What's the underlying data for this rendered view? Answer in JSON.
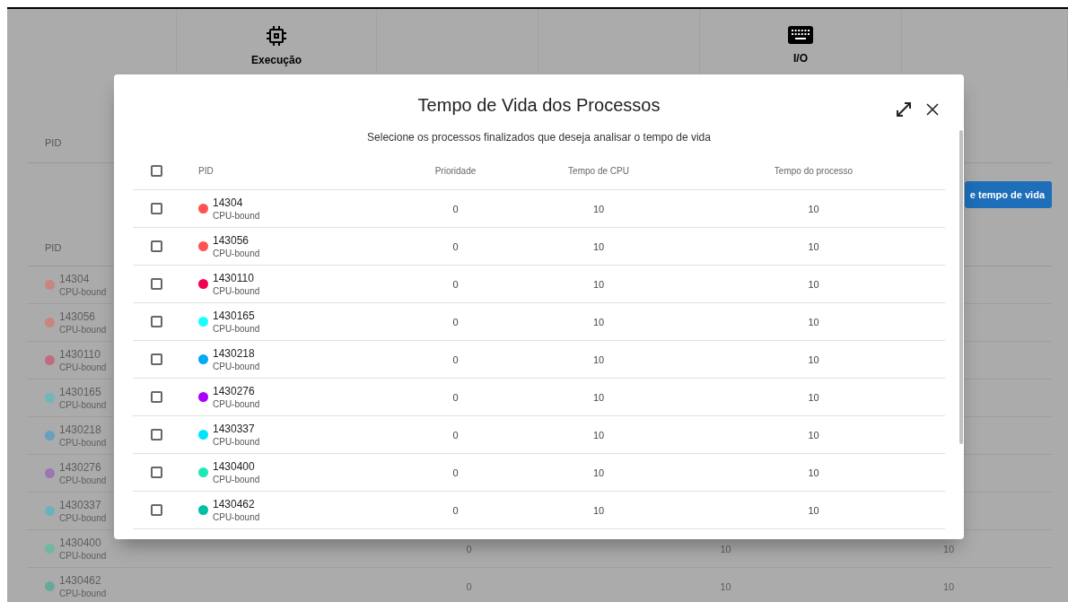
{
  "tabs": [
    {
      "kind": "empty"
    },
    {
      "kind": "cpu",
      "label": "Execução"
    },
    {
      "kind": "empty"
    },
    {
      "kind": "empty"
    },
    {
      "kind": "io",
      "label": "I/O"
    },
    {
      "kind": "empty"
    }
  ],
  "section_1": {
    "header": "PID"
  },
  "action_button": {
    "label": "e tempo de vida"
  },
  "background_table": {
    "header": "PID",
    "rows": [
      {
        "pid": "14304",
        "type": "CPU-bound",
        "color": "#c98580"
      },
      {
        "pid": "143056",
        "type": "CPU-bound",
        "color": "#c98580"
      },
      {
        "pid": "1430110",
        "type": "CPU-bound",
        "color": "#c26b80"
      },
      {
        "pid": "1430165",
        "type": "CPU-bound",
        "color": "#6fb8b8"
      },
      {
        "pid": "1430218",
        "type": "CPU-bound",
        "color": "#6a9fc0"
      },
      {
        "pid": "1430276",
        "type": "CPU-bound",
        "color": "#9c75b5"
      },
      {
        "pid": "1430337",
        "type": "CPU-bound",
        "color": "#6bb2bf"
      },
      {
        "pid": "1430400",
        "type": "CPU-bound",
        "color": "#72b8a0",
        "priority": "0",
        "cpu_time": "10",
        "process_time": "10"
      },
      {
        "pid": "1430462",
        "type": "CPU-bound",
        "color": "#6aa89c",
        "priority": "0",
        "cpu_time": "10",
        "process_time": "10"
      }
    ]
  },
  "dialog": {
    "title": "Tempo de Vida dos Processos",
    "subtitle": "Selecione os processos finalizados que deseja analisar o tempo de vida",
    "select_all_checked": false,
    "columns": [
      "PID",
      "Prioridade",
      "Tempo de CPU",
      "Tempo do processo"
    ],
    "rows": [
      {
        "checked": false,
        "pid": "14304",
        "type": "CPU-bound",
        "color": "#ff5252",
        "priority": "0",
        "cpu_time": "10",
        "process_time": "10"
      },
      {
        "checked": false,
        "pid": "143056",
        "type": "CPU-bound",
        "color": "#ff5252",
        "priority": "0",
        "cpu_time": "10",
        "process_time": "10"
      },
      {
        "checked": false,
        "pid": "1430110",
        "type": "CPU-bound",
        "color": "#f50057",
        "priority": "0",
        "cpu_time": "10",
        "process_time": "10"
      },
      {
        "checked": false,
        "pid": "1430165",
        "type": "CPU-bound",
        "color": "#18ffff",
        "priority": "0",
        "cpu_time": "10",
        "process_time": "10"
      },
      {
        "checked": false,
        "pid": "1430218",
        "type": "CPU-bound",
        "color": "#03a9f4",
        "priority": "0",
        "cpu_time": "10",
        "process_time": "10"
      },
      {
        "checked": false,
        "pid": "1430276",
        "type": "CPU-bound",
        "color": "#aa00ff",
        "priority": "0",
        "cpu_time": "10",
        "process_time": "10"
      },
      {
        "checked": false,
        "pid": "1430337",
        "type": "CPU-bound",
        "color": "#00e5ff",
        "priority": "0",
        "cpu_time": "10",
        "process_time": "10"
      },
      {
        "checked": false,
        "pid": "1430400",
        "type": "CPU-bound",
        "color": "#1de9b6",
        "priority": "0",
        "cpu_time": "10",
        "process_time": "10"
      },
      {
        "checked": false,
        "pid": "1430462",
        "type": "CPU-bound",
        "color": "#00bfa5",
        "priority": "0",
        "cpu_time": "10",
        "process_time": "10"
      }
    ]
  }
}
